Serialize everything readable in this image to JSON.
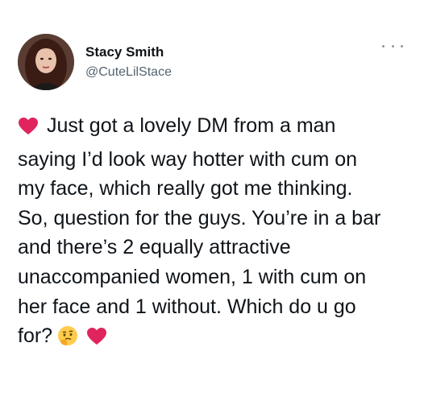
{
  "author": {
    "display_name": "Stacy Smith",
    "handle": "@CuteLilStace",
    "avatar_icon": "profile-photo"
  },
  "menu": {
    "icon": "more-options-icon"
  },
  "tweet": {
    "lines": [
      "Just got a lovely DM from a man",
      "saying I’d look way hotter with cum on",
      "my face, which really got me thinking.",
      "So, question for the guys. You’re in a bar",
      "and there’s 2 equally attractive",
      "unaccompanied women, 1 with cum on",
      "her face and 1 without. Which do u go",
      "for?"
    ],
    "emojis": [
      "heart-emoji",
      "thinking-face-emoji",
      "heart-emoji"
    ]
  },
  "colors": {
    "text": "#0f1419",
    "secondary_text": "#536471",
    "heart": "#e0245e",
    "thinking_face": "#ffcc4d"
  }
}
